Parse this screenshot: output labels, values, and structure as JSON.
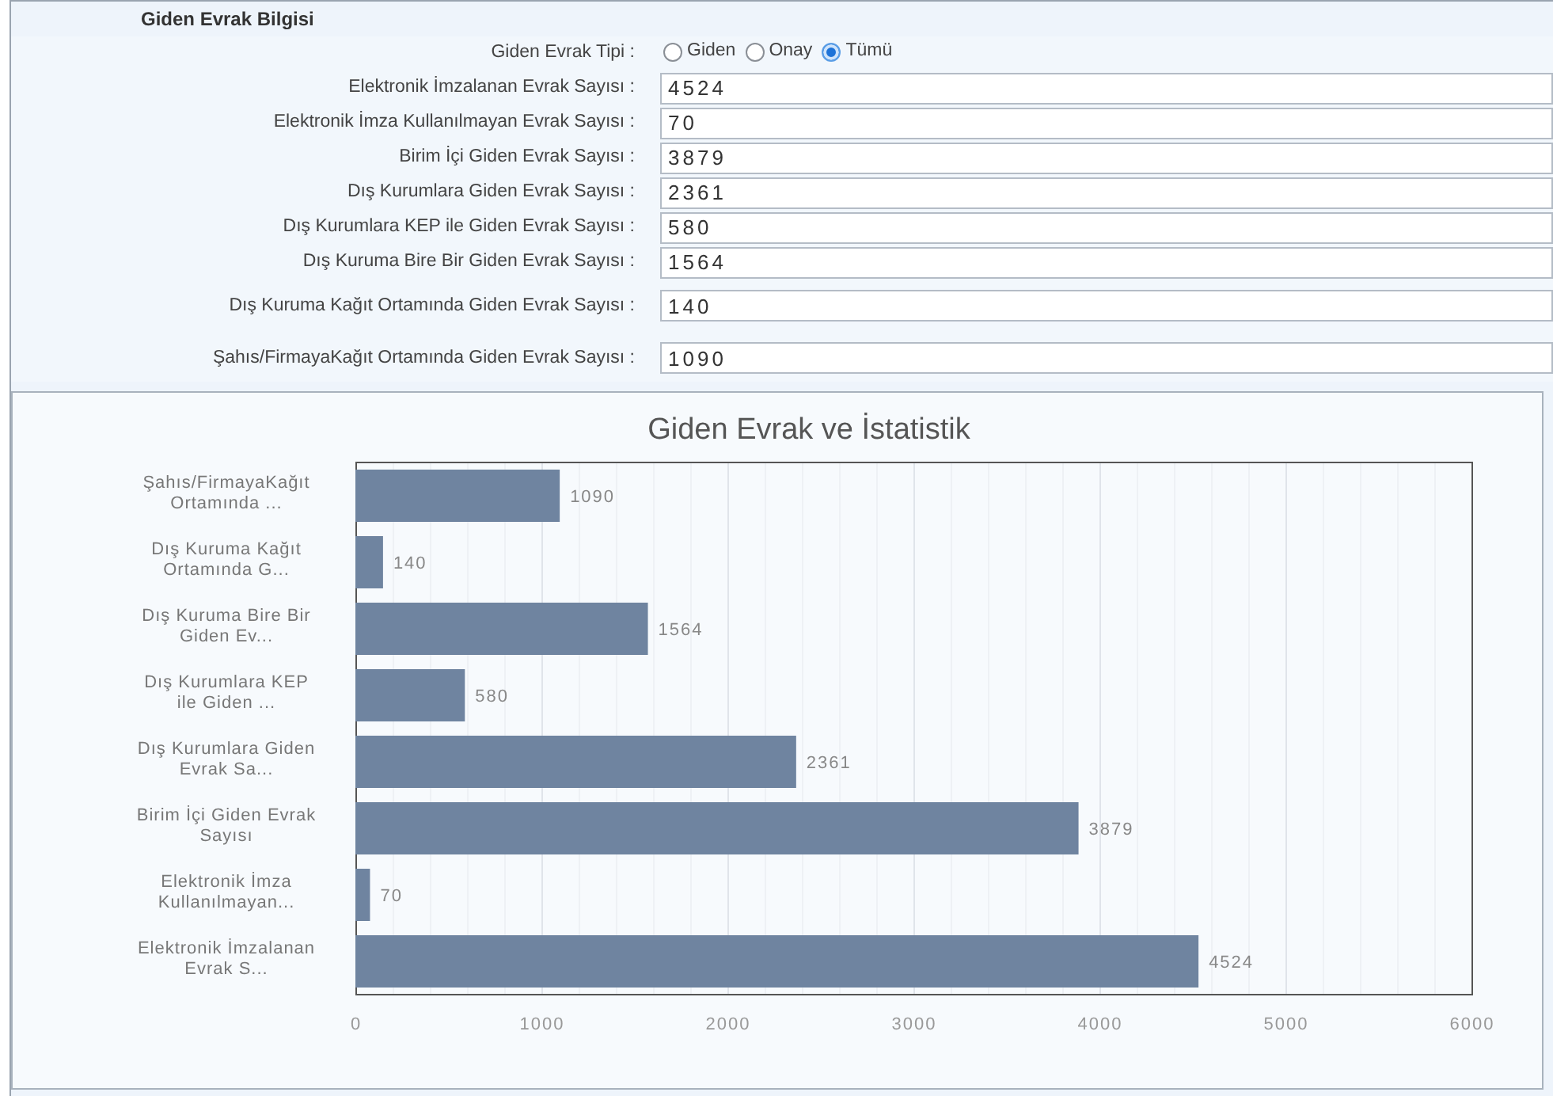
{
  "section_title": "Giden Evrak Bilgisi",
  "type_field": {
    "label": "Giden Evrak Tipi :",
    "options": [
      {
        "label": "Giden",
        "selected": false
      },
      {
        "label": "Onay",
        "selected": false
      },
      {
        "label": "Tümü",
        "selected": true
      }
    ]
  },
  "fields": [
    {
      "label": "Elektronik İmzalanan Evrak Sayısı :",
      "value": "4524"
    },
    {
      "label": "Elektronik İmza Kullanılmayan Evrak Sayısı :",
      "value": "70"
    },
    {
      "label": "Birim İçi Giden Evrak Sayısı :",
      "value": "3879"
    },
    {
      "label": "Dış Kurumlara Giden Evrak Sayısı :",
      "value": "2361"
    },
    {
      "label": "Dış Kurumlara KEP ile Giden Evrak Sayısı :",
      "value": "580"
    },
    {
      "label": "Dış Kuruma Bire Bir Giden Evrak Sayısı :",
      "value": "1564"
    },
    {
      "label": "Dış Kuruma Kağıt Ortamında Giden Evrak Sayısı :",
      "value": "140"
    },
    {
      "label": "Şahıs/FirmayaKağıt Ortamında Giden Evrak Sayısı :",
      "value": "1090"
    }
  ],
  "chart": {
    "chart_data": {
      "type": "bar",
      "orientation": "horizontal",
      "title": "Giden Evrak ve İstatistik",
      "categories": [
        "Şahıs/FirmayaKağıt Ortamında ...",
        "Dış Kuruma Kağıt Ortamında G...",
        "Dış Kuruma Bire Bir Giden Ev...",
        "Dış Kurumlara KEP ile Giden ...",
        "Dış Kurumlara Giden Evrak Sa...",
        "Birim İçi Giden Evrak Sayısı",
        "Elektronik İmza Kullanılmayan...",
        "Elektronik İmzalanan Evrak S..."
      ],
      "series": [
        {
          "color": "#6f84a0",
          "values": [
            1090,
            140,
            1564,
            580,
            2361,
            3879,
            70,
            4524
          ]
        }
      ],
      "xlim": [
        0,
        6000
      ],
      "grid": true,
      "xticks": [
        0,
        1000,
        2000,
        3000,
        4000,
        5000,
        6000
      ],
      "value_labels": [
        "1090",
        "140",
        "1564",
        "580",
        "2361",
        "3879",
        "70",
        "4524"
      ]
    }
  }
}
